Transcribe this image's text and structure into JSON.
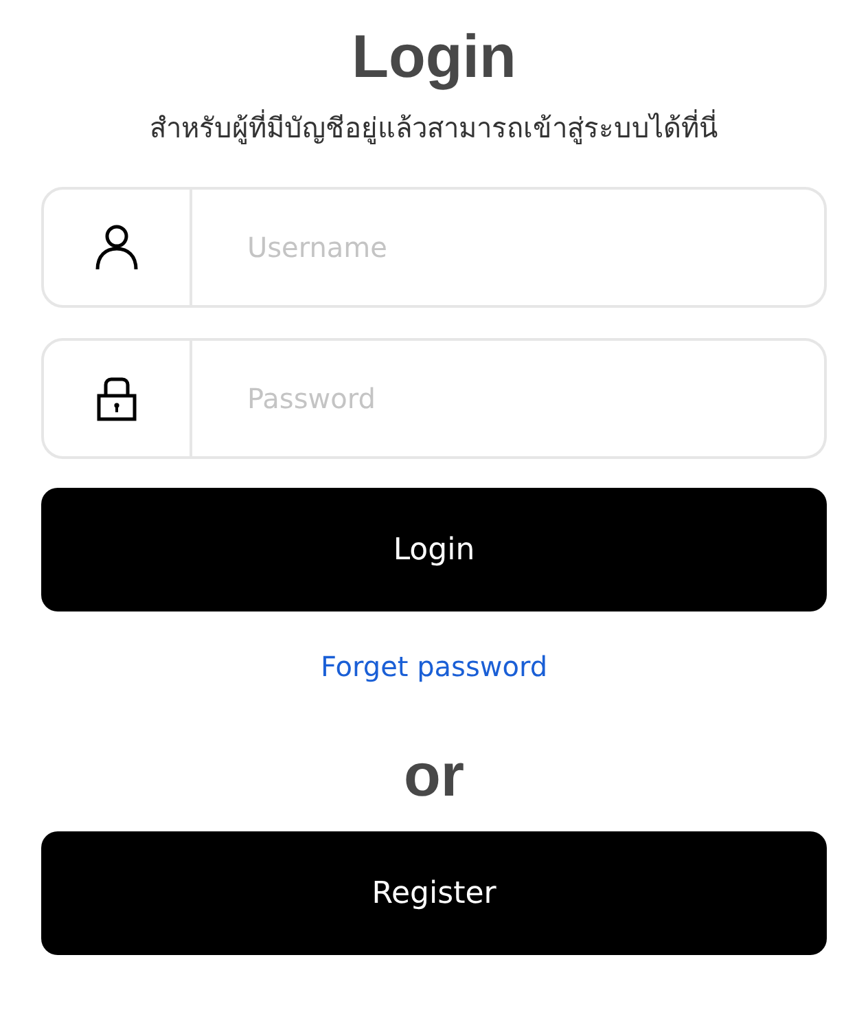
{
  "title": "Login",
  "subtitle": "สำหรับผู้ที่มีบัญชีอยู่แล้วสามารถเข้าสู่ระบบได้ที่นี่",
  "fields": [
    {
      "kind": "user",
      "placeholder": "Username"
    },
    {
      "kind": "password",
      "placeholder": "Password"
    }
  ],
  "login_button": "Login",
  "forgot_link": "Forget password",
  "separator": "or",
  "register_button": "Register"
}
